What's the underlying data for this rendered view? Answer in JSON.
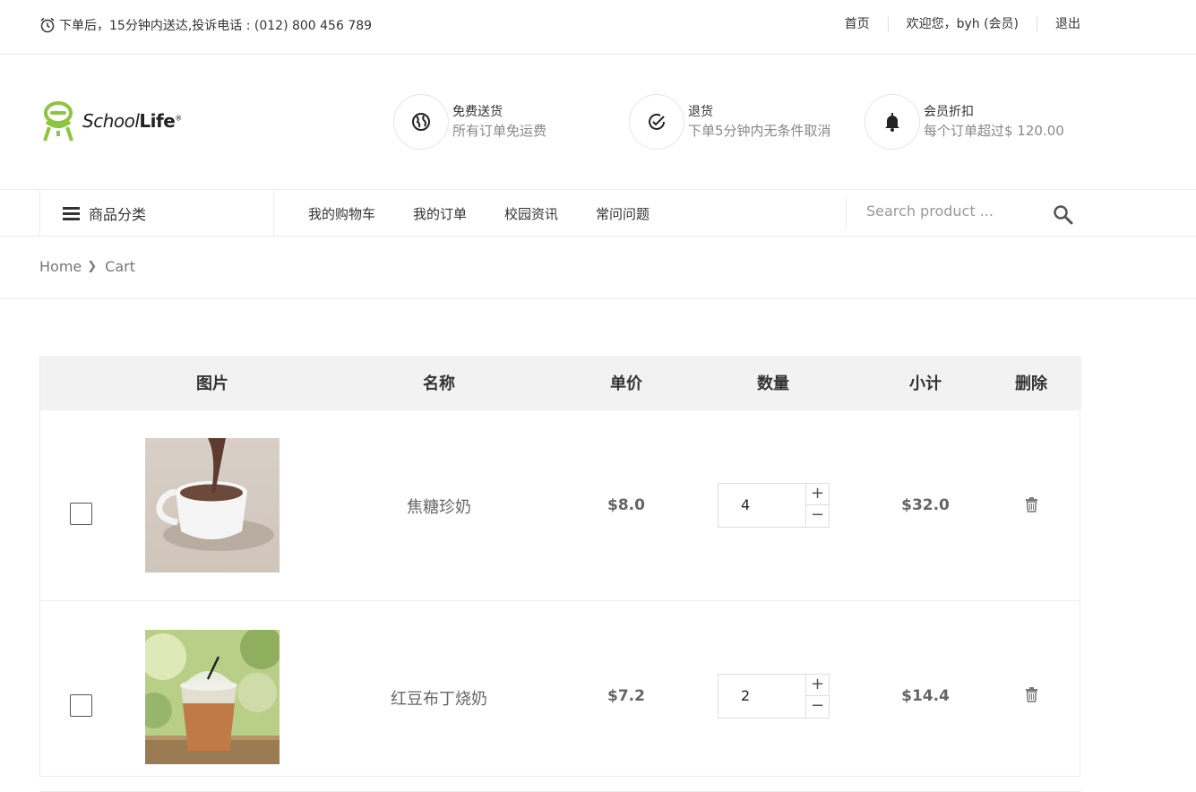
{
  "topbar": {
    "notice": "下单后，15分钟内送达,投诉电话 : (012) 800 456 789",
    "links": [
      "首页",
      "欢迎您，byh (会员)",
      "退出"
    ]
  },
  "logo": {
    "text_a": "School",
    "text_b": "Life",
    "mark": "®"
  },
  "features": [
    {
      "icon": "globe-icon",
      "title": "免费送货",
      "subtitle": "所有订单免运费"
    },
    {
      "icon": "check-circle-icon",
      "title": "退货",
      "subtitle": "下单5分钟内无条件取消"
    },
    {
      "icon": "bell-icon",
      "title": "会员折扣",
      "subtitle": "每个订单超过$ 120.00"
    }
  ],
  "nav": {
    "category_label": "商品分类",
    "menu": [
      "我的购物车",
      "我的订单",
      "校园资讯",
      "常问问题"
    ],
    "search_placeholder": "Search product ..."
  },
  "breadcrumb": {
    "home": "Home",
    "current": "Cart"
  },
  "cart": {
    "headers": [
      "图片",
      "名称",
      "单价",
      "数量",
      "小计",
      "删除"
    ],
    "items": [
      {
        "name": "焦糖珍奶",
        "price": "$8.0",
        "quantity": "4",
        "subtotal": "$32.0",
        "checked": false,
        "image": "hot-chocolate-cup"
      },
      {
        "name": "红豆布丁烧奶",
        "price": "$7.2",
        "quantity": "2",
        "subtotal": "$14.4",
        "checked": false,
        "image": "iced-milk-tea-cup"
      }
    ],
    "plus_label": "+",
    "minus_label": "−"
  }
}
